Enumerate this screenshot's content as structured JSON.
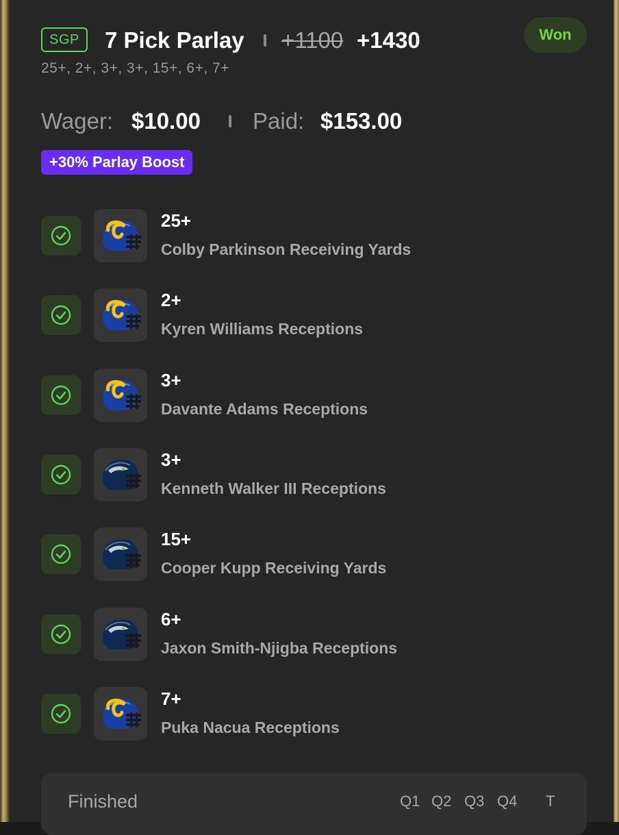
{
  "header": {
    "badge": "SGP",
    "title": "7 Pick Parlay",
    "old_odds": "+1100",
    "new_odds": "+1430",
    "lines_summary": "25+, 2+, 3+, 3+, 15+, 6+, 7+",
    "status": "Won"
  },
  "wager": {
    "wager_label": "Wager:",
    "wager_value": "$10.00",
    "paid_label": "Paid:",
    "paid_value": "$153.00",
    "boost": "+30% Parlay Boost"
  },
  "legs": [
    {
      "line": "25+",
      "desc": "Colby Parkinson Receiving Yards",
      "team": "rams",
      "result": "won"
    },
    {
      "line": "2+",
      "desc": "Kyren Williams Receptions",
      "team": "rams",
      "result": "won"
    },
    {
      "line": "3+",
      "desc": "Davante Adams Receptions",
      "team": "rams",
      "result": "won"
    },
    {
      "line": "3+",
      "desc": "Kenneth Walker III Receptions",
      "team": "seahawks",
      "result": "won"
    },
    {
      "line": "15+",
      "desc": "Cooper Kupp Receiving Yards",
      "team": "seahawks",
      "result": "won"
    },
    {
      "line": "6+",
      "desc": "Jaxon Smith-Njigba Receptions",
      "team": "seahawks",
      "result": "won"
    },
    {
      "line": "7+",
      "desc": "Puka Nacua Receptions",
      "team": "rams",
      "result": "won"
    }
  ],
  "footer": {
    "status": "Finished",
    "quarters": [
      "Q1",
      "Q2",
      "Q3",
      "Q4",
      "T"
    ]
  },
  "colors": {
    "background": "#262626",
    "accent_green": "#5fd35f",
    "won_badge_bg": "#2d3d24",
    "boost_purple": "#6a2cf0",
    "rams_blue": "#1b3fa0",
    "rams_gold": "#f2c41c",
    "seahawks_navy": "#0e2a52",
    "seahawks_green": "#69be28"
  }
}
